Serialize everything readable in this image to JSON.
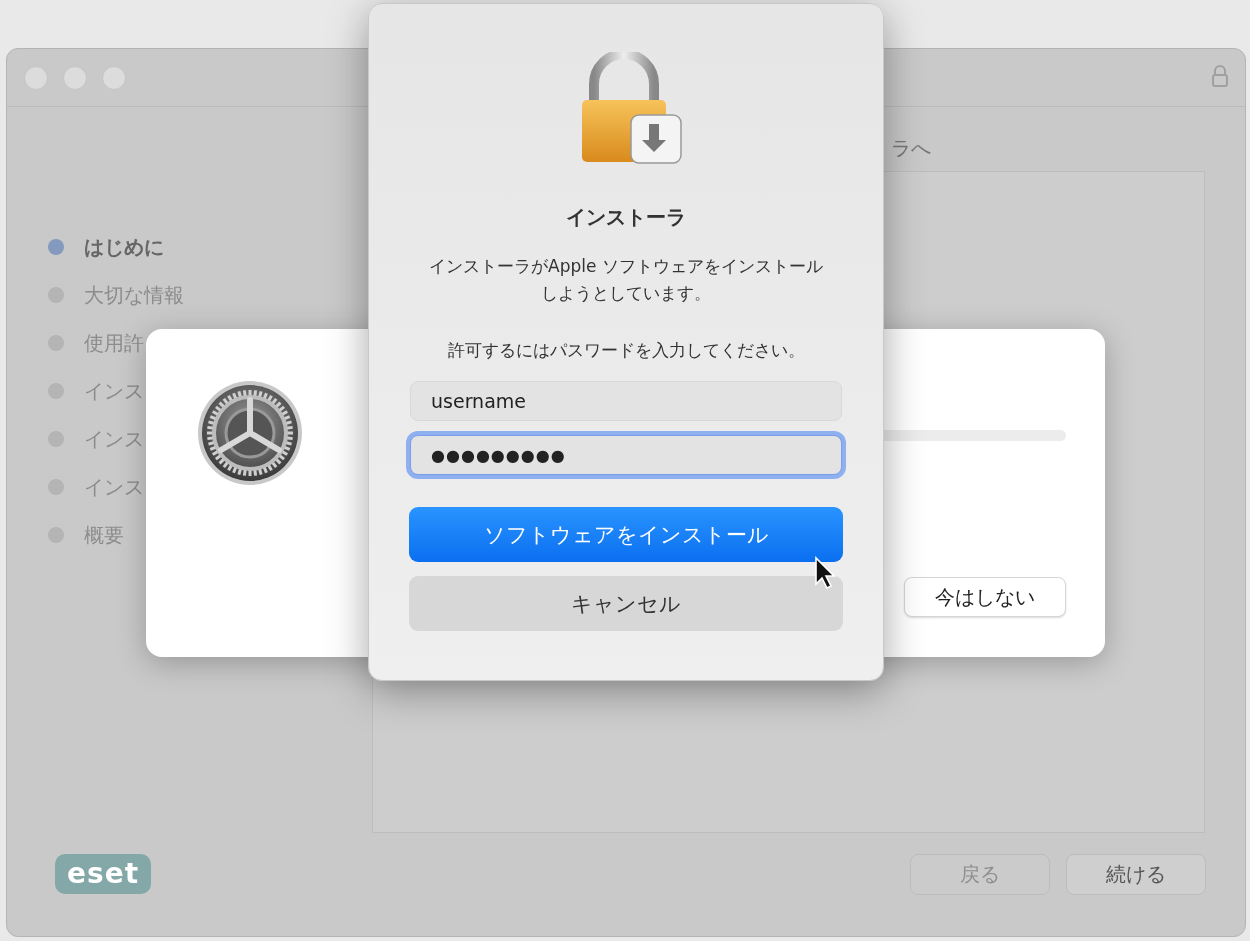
{
  "installer_window": {
    "sidebar": [
      {
        "label": "はじめに",
        "selected": true
      },
      {
        "label": "大切な情報",
        "selected": false
      },
      {
        "label": "使用許",
        "selected": false
      },
      {
        "label": "インス",
        "selected": false
      },
      {
        "label": "インス",
        "selected": false
      },
      {
        "label": "インス",
        "selected": false
      },
      {
        "label": "概要",
        "selected": false
      }
    ],
    "heading": "ラへ",
    "logo": "eset",
    "buttons": [
      {
        "label": "戻る",
        "disabled": true
      },
      {
        "label": "続ける",
        "disabled": false
      }
    ]
  },
  "update_dialog": {
    "button": "今はしない"
  },
  "auth_dialog": {
    "title": "インストーラ",
    "message": "インストーラがApple ソフトウェアをインストールしようとしています。",
    "prompt": "許可するにはパスワードを入力してください。",
    "username": {
      "value": "username",
      "focused": false
    },
    "password": {
      "value": "●●●●●●●●●",
      "focused": true
    },
    "buttons": [
      {
        "label": "ソフトウェアをインストール",
        "kind": "primary"
      },
      {
        "label": "キャンセル",
        "kind": "secondary"
      }
    ]
  }
}
